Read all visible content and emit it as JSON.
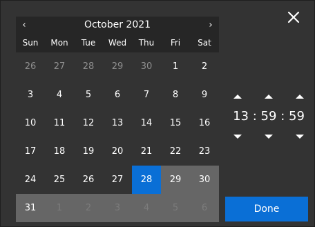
{
  "header": {
    "month_label": "October 2021",
    "prev_glyph": "‹",
    "next_glyph": "›"
  },
  "weekdays": [
    "Sun",
    "Mon",
    "Tue",
    "Wed",
    "Thu",
    "Fri",
    "Sat"
  ],
  "weeks": [
    [
      "26",
      "27",
      "28",
      "29",
      "30",
      "1",
      "2"
    ],
    [
      "3",
      "4",
      "5",
      "6",
      "7",
      "8",
      "9"
    ],
    [
      "10",
      "11",
      "12",
      "13",
      "14",
      "15",
      "16"
    ],
    [
      "17",
      "18",
      "19",
      "20",
      "21",
      "22",
      "23"
    ],
    [
      "24",
      "25",
      "26",
      "27",
      "28",
      "29",
      "30"
    ],
    [
      "31",
      "1",
      "2",
      "3",
      "4",
      "5",
      "6"
    ]
  ],
  "time": {
    "hours": "13",
    "minutes": "59",
    "seconds": "59",
    "separator": ":"
  },
  "done_label": "Done",
  "icons": {
    "close": "close-icon",
    "increment": "up-arrow-icon",
    "decrement": "down-arrow-icon"
  },
  "colors": {
    "background": "#333333",
    "header_bg": "#262626",
    "selected": "#0a6fd6",
    "highlight": "#666666",
    "muted_text": "#8f8f8f"
  }
}
